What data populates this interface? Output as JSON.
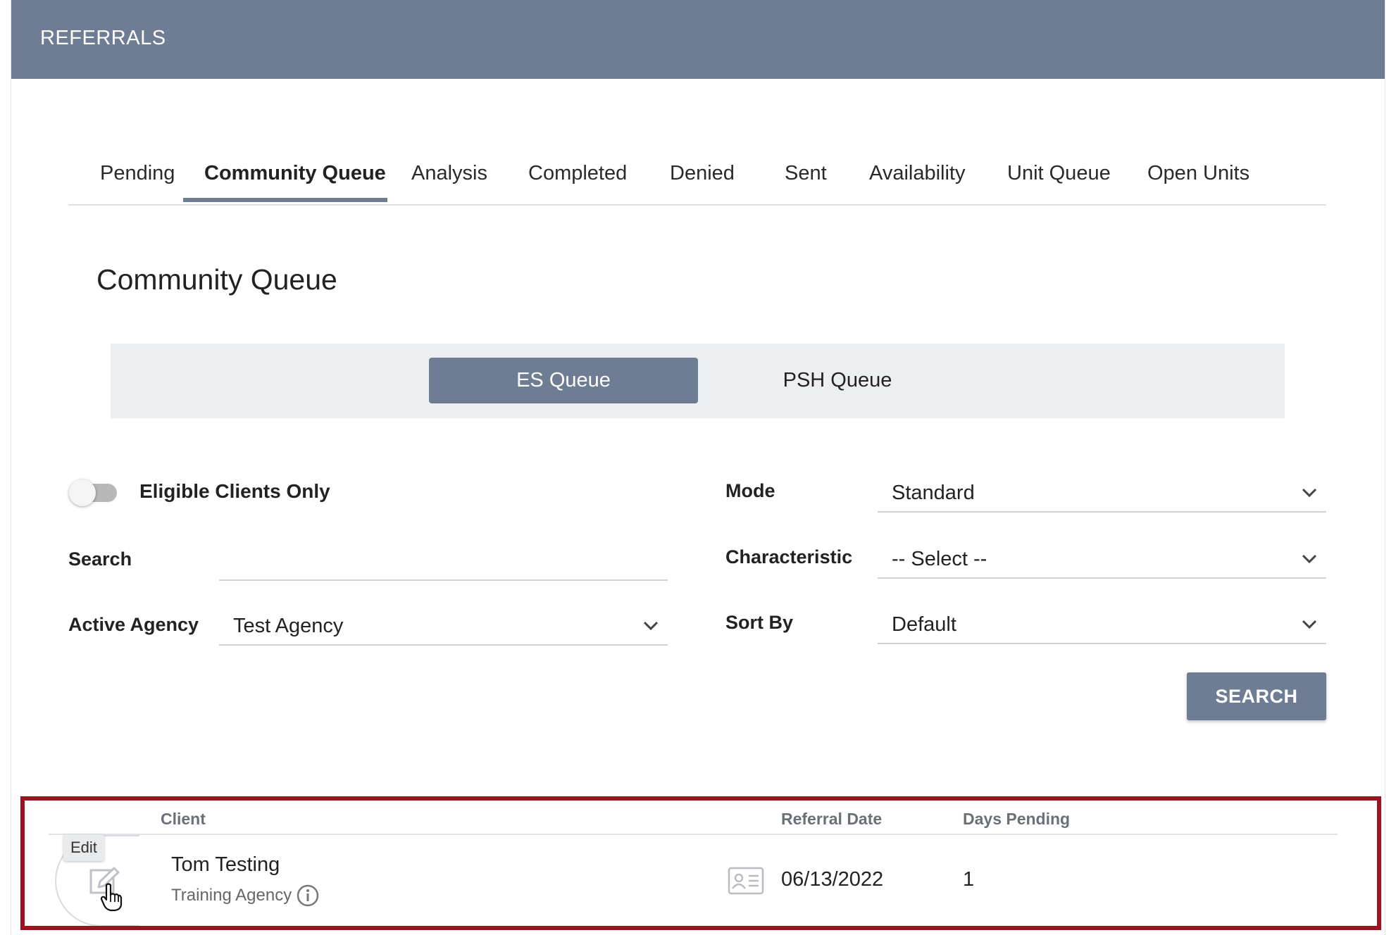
{
  "header": {
    "title": "REFERRALS"
  },
  "tabs": [
    {
      "label": "Pending"
    },
    {
      "label": "Community Queue"
    },
    {
      "label": "Analysis"
    },
    {
      "label": "Completed"
    },
    {
      "label": "Denied"
    },
    {
      "label": "Sent"
    },
    {
      "label": "Availability"
    },
    {
      "label": "Unit Queue"
    },
    {
      "label": "Open Units"
    }
  ],
  "active_tab": "Community Queue",
  "section": {
    "title": "Community Queue"
  },
  "queue_toggle": {
    "es_label": "ES Queue",
    "psh_label": "PSH Queue",
    "selected": "ES Queue"
  },
  "filters": {
    "eligible_label": "Eligible Clients Only",
    "eligible_on": false,
    "search_label": "Search",
    "search_value": "",
    "active_agency_label": "Active Agency",
    "active_agency_value": "Test Agency",
    "mode_label": "Mode",
    "mode_value": "Standard",
    "characteristic_label": "Characteristic",
    "characteristic_value": "-- Select --",
    "sort_by_label": "Sort By",
    "sort_by_value": "Default",
    "search_button": "SEARCH"
  },
  "results": {
    "columns": {
      "client": "Client",
      "referral_date": "Referral Date",
      "days_pending": "Days Pending"
    },
    "rows": [
      {
        "client_name": "Tom Testing",
        "agency": "Training Agency",
        "referral_date": "06/13/2022",
        "days_pending": "1"
      }
    ],
    "edit_tooltip": "Edit"
  },
  "colors": {
    "header": "#6e7d94",
    "accent": "#6e7d94",
    "highlight_border": "#a0101e",
    "queue_bar_bg": "#eceef2"
  }
}
